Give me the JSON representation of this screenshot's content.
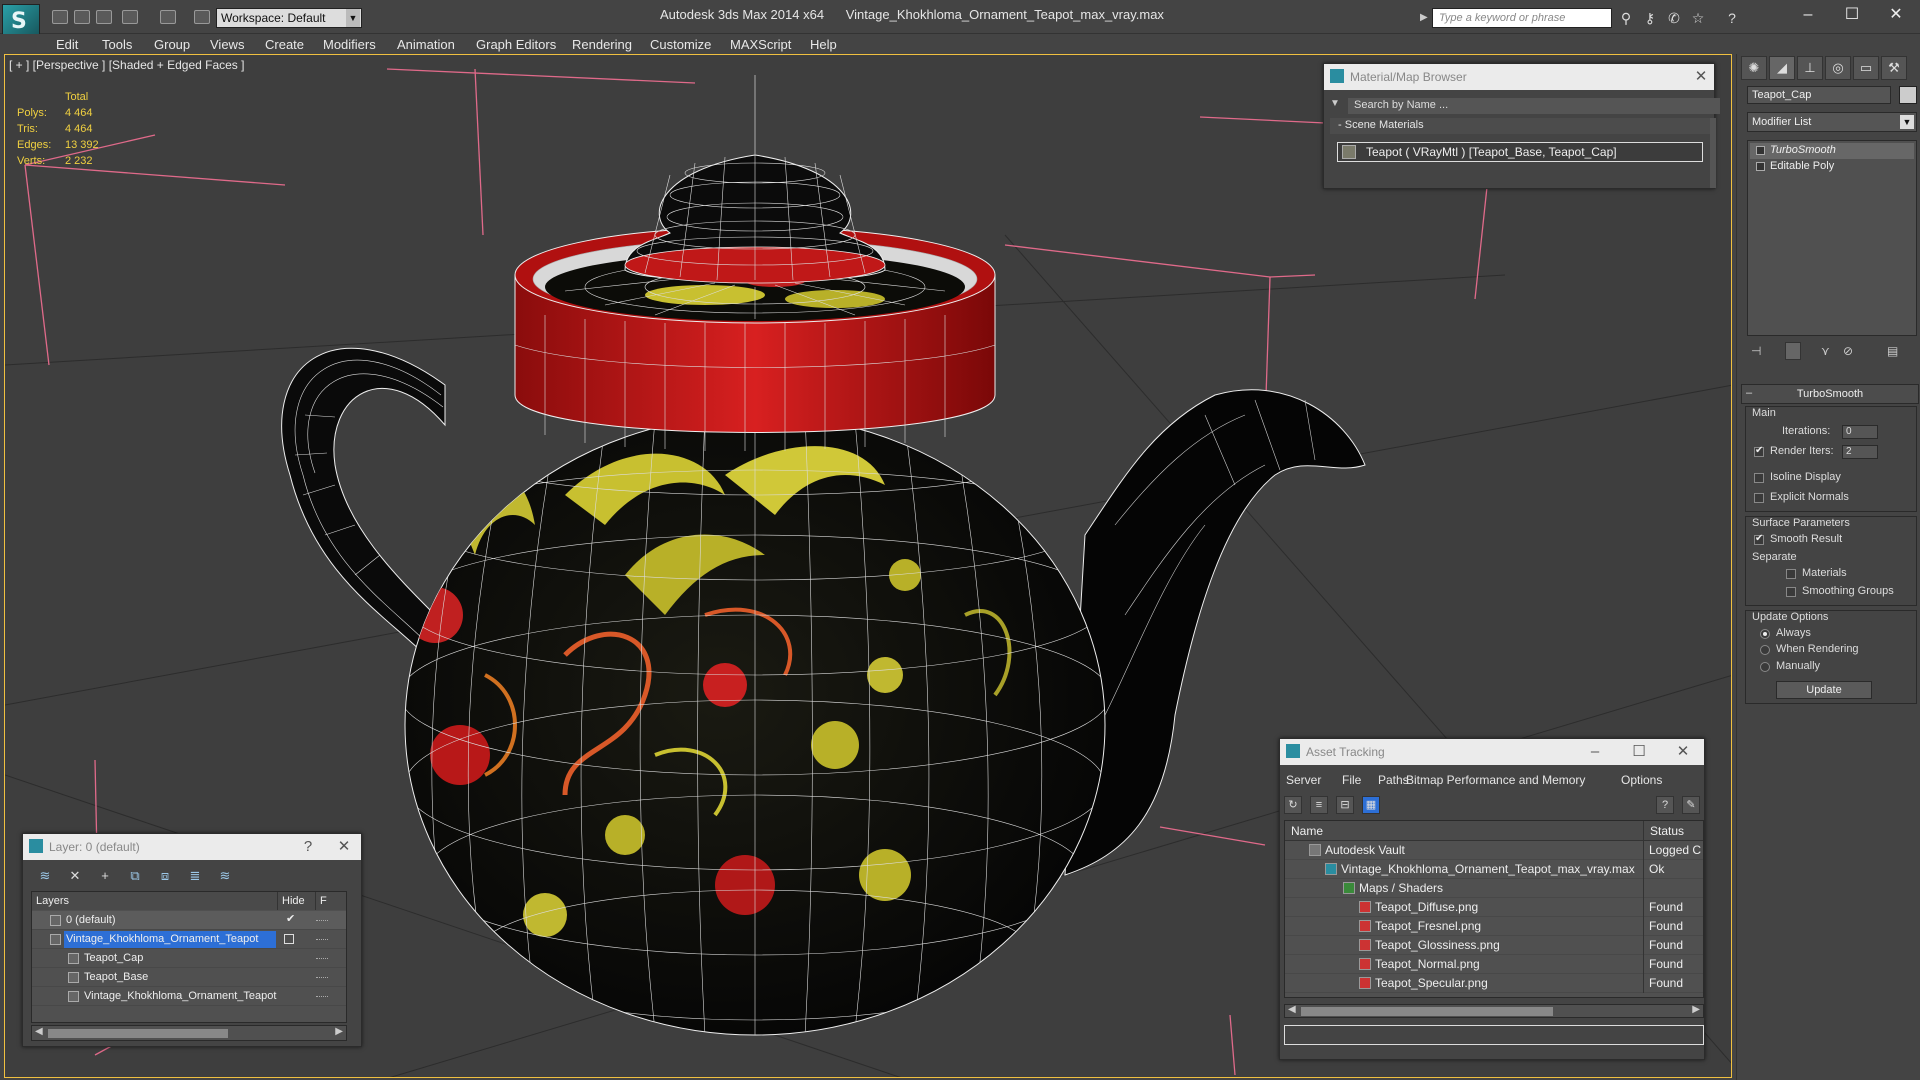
{
  "title_bar": {
    "app_title": "Autodesk 3ds Max  2014 x64",
    "file_name": "Vintage_Khokhloma_Ornament_Teapot_max_vray.max",
    "workspace": "Workspace: Default",
    "search_placeholder": "Type a keyword or phrase"
  },
  "menu": [
    "Edit",
    "Tools",
    "Group",
    "Views",
    "Create",
    "Modifiers",
    "Animation",
    "Graph Editors",
    "Rendering",
    "Customize",
    "MAXScript",
    "Help"
  ],
  "viewport": {
    "label": "[ + ] [Perspective ] [Shaded + Edged Faces ]",
    "stats": {
      "header": "Total",
      "rows": [
        {
          "key": "Polys:",
          "value": "4 464"
        },
        {
          "key": "Tris:",
          "value": "4 464"
        },
        {
          "key": "Edges:",
          "value": "13 392"
        },
        {
          "key": "Verts:",
          "value": "2 232"
        }
      ]
    }
  },
  "material_browser": {
    "title": "Material/Map Browser",
    "search_placeholder": "Search by Name ...",
    "section": "Scene Materials",
    "item": "Teapot  ( VRayMtl ) [Teapot_Base, Teapot_Cap]"
  },
  "command_panel": {
    "object_name": "Teapot_Cap",
    "modifier_list": "Modifier List",
    "stack": [
      "TurboSmooth",
      "Editable Poly"
    ],
    "turbosmooth": {
      "title": "TurboSmooth",
      "main": "Main",
      "iterations_label": "Iterations:",
      "iterations_value": "0",
      "render_iters_label": "Render Iters:",
      "render_iters_value": "2",
      "isoline": "Isoline Display",
      "explicit_normals": "Explicit Normals",
      "surface_params": "Surface Parameters",
      "smooth_result": "Smooth Result",
      "separate": "Separate",
      "materials": "Materials",
      "smoothing_groups": "Smoothing Groups",
      "update_options": "Update Options",
      "always": "Always",
      "when_rendering": "When Rendering",
      "manually": "Manually",
      "update_button": "Update"
    }
  },
  "layer_window": {
    "title": "Layer: 0 (default)",
    "col_layers": "Layers",
    "col_hide": "Hide",
    "col_f": "F",
    "rows": [
      {
        "name": "0 (default)",
        "indent": 1
      },
      {
        "name": "Vintage_Khokhloma_Ornament_Teapot",
        "indent": 1
      },
      {
        "name": "Teapot_Cap",
        "indent": 2
      },
      {
        "name": "Teapot_Base",
        "indent": 2
      },
      {
        "name": "Vintage_Khokhloma_Ornament_Teapot",
        "indent": 2
      }
    ]
  },
  "asset_tracking": {
    "title": "Asset Tracking",
    "menu": [
      "Server",
      "File",
      "Paths",
      "Bitmap Performance and Memory",
      "Options"
    ],
    "col_name": "Name",
    "col_status": "Status",
    "rows": [
      {
        "name": "Autodesk Vault",
        "status": "Logged C",
        "indent": 1
      },
      {
        "name": "Vintage_Khokhloma_Ornament_Teapot_max_vray.max",
        "status": "Ok",
        "indent": 2
      },
      {
        "name": "Maps / Shaders",
        "status": "",
        "indent": 3
      },
      {
        "name": "Teapot_Diffuse.png",
        "status": "Found",
        "indent": 4
      },
      {
        "name": "Teapot_Fresnel.png",
        "status": "Found",
        "indent": 4
      },
      {
        "name": "Teapot_Glossiness.png",
        "status": "Found",
        "indent": 4
      },
      {
        "name": "Teapot_Normal.png",
        "status": "Found",
        "indent": 4
      },
      {
        "name": "Teapot_Specular.png",
        "status": "Found",
        "indent": 4
      }
    ]
  },
  "colors": {
    "accent": "#2d6fd6",
    "stats_text": "#f0d040",
    "teapot_red": "#c01818",
    "ornament_yellow": "#d8d030"
  }
}
